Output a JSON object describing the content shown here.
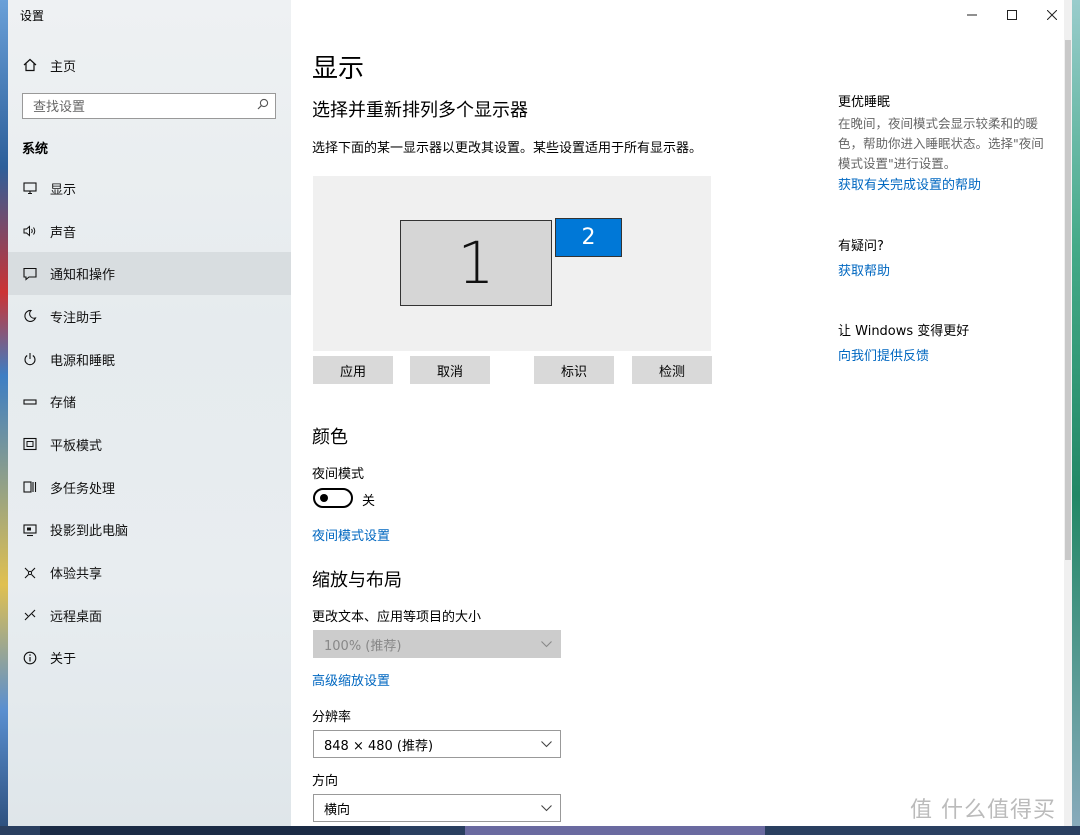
{
  "window": {
    "title": "设置",
    "controls": {
      "minimize": "—",
      "maximize": "☐",
      "close": "✕"
    }
  },
  "sidebar": {
    "home": {
      "label": "主页",
      "icon": "home-icon"
    },
    "search": {
      "placeholder": "查找设置",
      "icon": "search-icon"
    },
    "section": "系统",
    "items": [
      {
        "label": "显示",
        "icon": "monitor-icon",
        "glyph": "🖵"
      },
      {
        "label": "声音",
        "icon": "speaker-icon",
        "glyph": "🔉"
      },
      {
        "label": "通知和操作",
        "icon": "message-icon",
        "glyph": "🗨"
      },
      {
        "label": "专注助手",
        "icon": "moon-icon",
        "glyph": "☽"
      },
      {
        "label": "电源和睡眠",
        "icon": "power-icon",
        "glyph": "⏻"
      },
      {
        "label": "存储",
        "icon": "storage-icon",
        "glyph": "▭"
      },
      {
        "label": "平板模式",
        "icon": "tablet-icon",
        "glyph": "⧉"
      },
      {
        "label": "多任务处理",
        "icon": "multitask-icon",
        "glyph": "⊟"
      },
      {
        "label": "投影到此电脑",
        "icon": "project-icon",
        "glyph": "⊡"
      },
      {
        "label": "体验共享",
        "icon": "share-icon",
        "glyph": "✲"
      },
      {
        "label": "远程桌面",
        "icon": "remote-icon",
        "glyph": "✗"
      },
      {
        "label": "关于",
        "icon": "info-icon",
        "glyph": "ⓘ"
      }
    ],
    "active_index": 2
  },
  "main": {
    "title": "显示",
    "arrange": {
      "heading": "选择并重新排列多个显示器",
      "description": "选择下面的某一显示器以更改其设置。某些设置适用于所有显示器。",
      "monitors": [
        "1",
        "2"
      ],
      "selected_monitor": "2",
      "buttons": {
        "apply": "应用",
        "cancel": "取消",
        "identify": "标识",
        "detect": "检测"
      }
    },
    "color": {
      "heading": "颜色",
      "night_mode_label": "夜间模式",
      "night_mode_state": "关",
      "night_mode_on": false,
      "night_mode_link": "夜间模式设置"
    },
    "scale": {
      "heading": "缩放与布局",
      "size_label": "更改文本、应用等项目的大小",
      "size_value": "100% (推荐)",
      "advanced_link": "高级缩放设置",
      "resolution_label": "分辨率",
      "resolution_value": "848 × 480 (推荐)",
      "orientation_label": "方向",
      "orientation_value": "横向"
    }
  },
  "aside": {
    "sleep": {
      "heading": "更优睡眠",
      "text": "在晚间，夜间模式会显示较柔和的暖色，帮助你进入睡眠状态。选择\"夜间模式设置\"进行设置。",
      "link": "获取有关完成设置的帮助"
    },
    "question": {
      "heading": "有疑问?",
      "link": "获取帮助"
    },
    "feedback": {
      "heading": "让 Windows 变得更好",
      "link": "向我们提供反馈"
    }
  },
  "watermark": "值 什么值得买",
  "colors": {
    "accent": "#0078d7",
    "link": "#0067c0",
    "active_nav": "#d8dde0"
  }
}
